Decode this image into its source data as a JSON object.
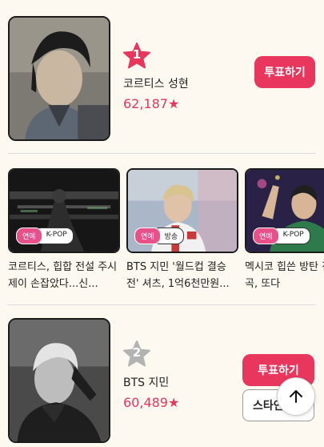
{
  "ranking": [
    {
      "rank": "1",
      "name": "코르티스 성현",
      "votes": "62,187★",
      "vote_label": "투표하기",
      "badge_color": "#e8365d"
    },
    {
      "rank": "2",
      "name": "BTS 지민",
      "votes": "60,489★",
      "vote_label": "투표하기",
      "secondary_label": "스타인",
      "badge_color": "#b3b3b3"
    }
  ],
  "news": [
    {
      "category": "연예",
      "subcategory": "K-POP",
      "title": "코르티스, 힙합 전설 주시 제이 손잡았다...신..."
    },
    {
      "category": "연예",
      "subcategory": "방송",
      "title": "BTS 지민 '월드컵 결승전' 셔츠, 1억6천만원..."
    },
    {
      "category": "연예",
      "subcategory": "K-POP",
      "title": "멕시코 힙쓴 방탄 진 솔로곡, 또다"
    }
  ],
  "icons": {
    "rank_badge": "star-icon",
    "scroll_top": "arrow-up-icon"
  },
  "colors": {
    "accent": "#e8365d",
    "tag": "#e8508a",
    "background": "#fdf9f0"
  }
}
